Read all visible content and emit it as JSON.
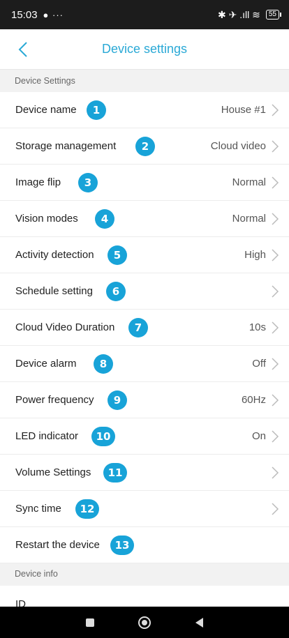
{
  "status_bar": {
    "time": "15:03",
    "left_icons": "● ···",
    "right_icons": "✱ ✈ .ıll ≋",
    "battery": "55"
  },
  "header": {
    "title": "Device settings"
  },
  "sections": {
    "device_settings": "Device Settings",
    "device_info": "Device info"
  },
  "rows": [
    {
      "label": "Device name",
      "value": "House #1",
      "badge": "1"
    },
    {
      "label": "Storage management",
      "value": "Cloud video",
      "badge": "2"
    },
    {
      "label": "Image flip",
      "value": "Normal",
      "badge": "3"
    },
    {
      "label": "Vision modes",
      "value": "Normal",
      "badge": "4"
    },
    {
      "label": "Activity detection",
      "value": "High",
      "badge": "5"
    },
    {
      "label": "Schedule setting",
      "value": "",
      "badge": "6"
    },
    {
      "label": "Cloud Video Duration",
      "value": "10s",
      "badge": "7"
    },
    {
      "label": "Device alarm",
      "value": "Off",
      "badge": "8"
    },
    {
      "label": "Power frequency",
      "value": "60Hz",
      "badge": "9"
    },
    {
      "label": "LED indicator",
      "value": "On",
      "badge": "10"
    },
    {
      "label": "Volume Settings",
      "value": "",
      "badge": "11"
    },
    {
      "label": "Sync time",
      "value": "",
      "badge": "12"
    },
    {
      "label": "Restart the device",
      "value": "",
      "badge": "13"
    }
  ],
  "device_info": {
    "id_label": "ID",
    "id_value": ""
  },
  "colors": {
    "accent": "#2aa9d6",
    "badge": "#18a3d8"
  }
}
